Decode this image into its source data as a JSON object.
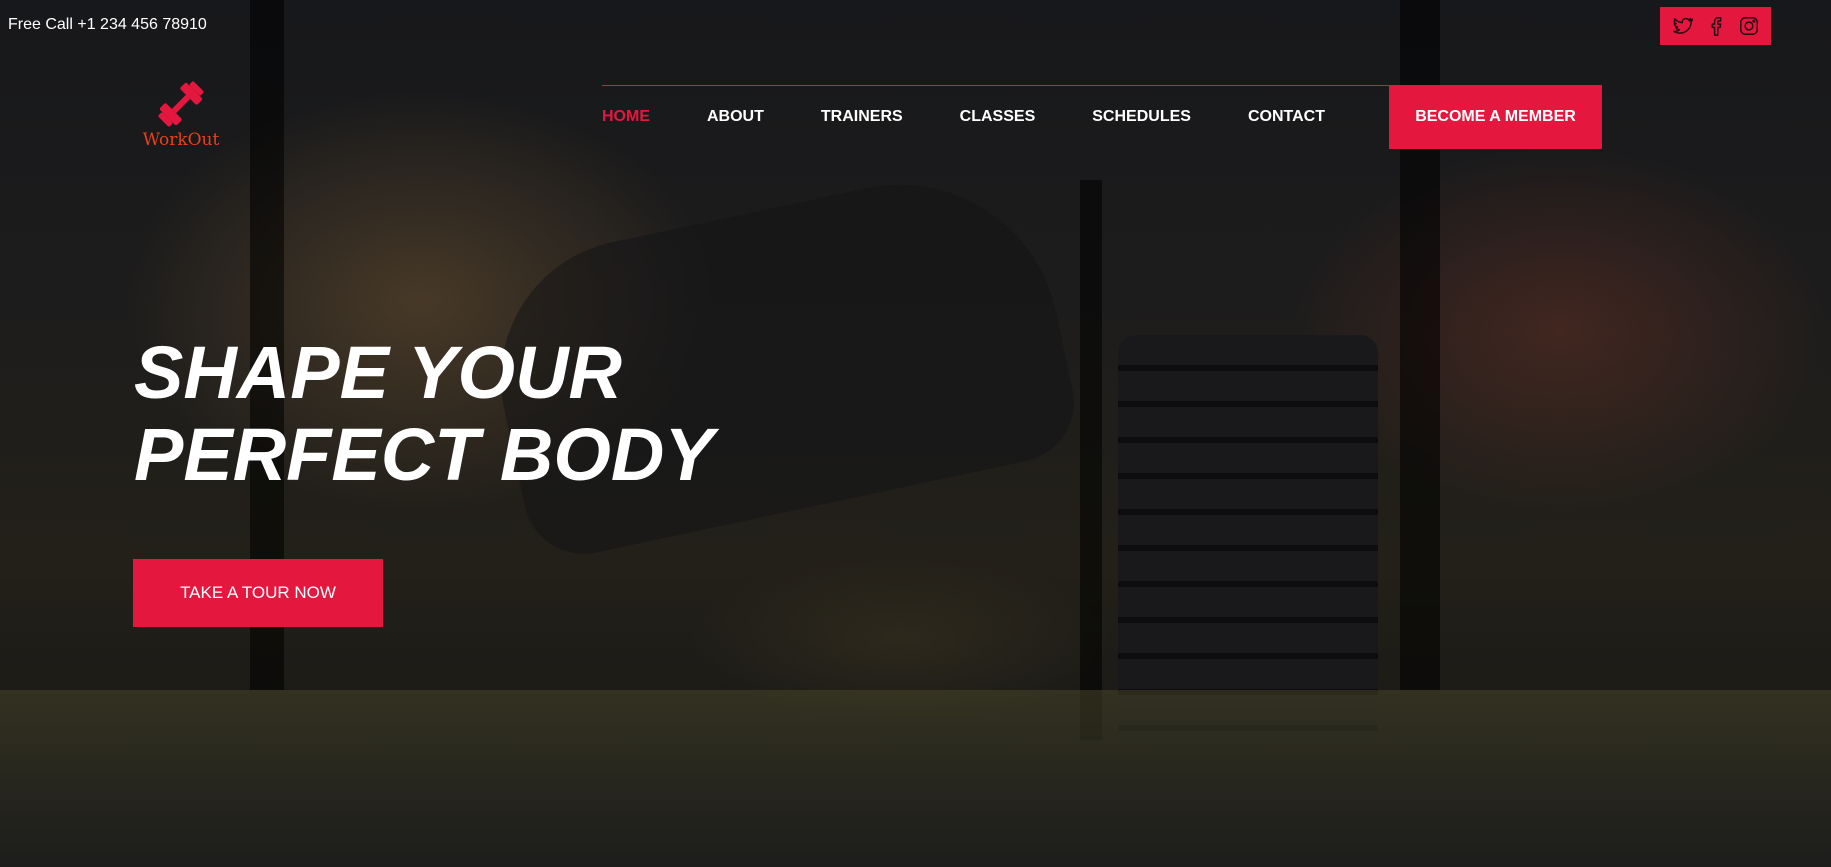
{
  "topbar": {
    "free_call": "Free Call +1 234 456 78910",
    "social": [
      {
        "icon": "twitter-icon"
      },
      {
        "icon": "facebook-icon"
      },
      {
        "icon": "instagram-icon"
      }
    ]
  },
  "logo": {
    "text": "WorkOut",
    "icon": "dumbbell-icon",
    "color": "#e8401a"
  },
  "nav": {
    "items": [
      {
        "label": "HOME",
        "active": true
      },
      {
        "label": "ABOUT",
        "active": false
      },
      {
        "label": "TRAINERS",
        "active": false
      },
      {
        "label": "CLASSES",
        "active": false
      },
      {
        "label": "SCHEDULES",
        "active": false
      },
      {
        "label": "CONTACT",
        "active": false
      }
    ],
    "cta_label": "BECOME A MEMBER"
  },
  "hero": {
    "title_line1": "SHAPE YOUR",
    "title_line2": "PERFECT BODY",
    "button_label": "TAKE A TOUR NOW"
  },
  "colors": {
    "accent": "#e4173f",
    "text": "#ffffff",
    "logo": "#e8401a"
  }
}
